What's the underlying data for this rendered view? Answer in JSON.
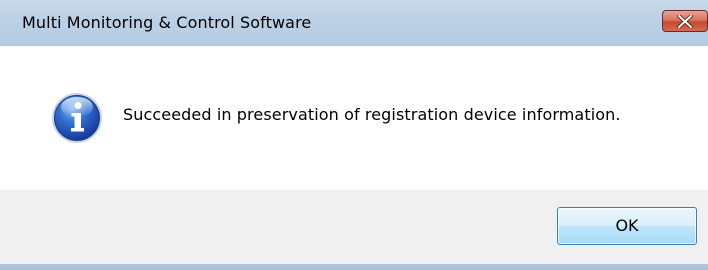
{
  "window": {
    "title": "Multi Monitoring & Control Software",
    "close_icon": "close-x-icon"
  },
  "message": {
    "icon": "information-icon",
    "text": "Succeeded in preservation of registration device information."
  },
  "buttons": {
    "ok_label": "OK"
  }
}
